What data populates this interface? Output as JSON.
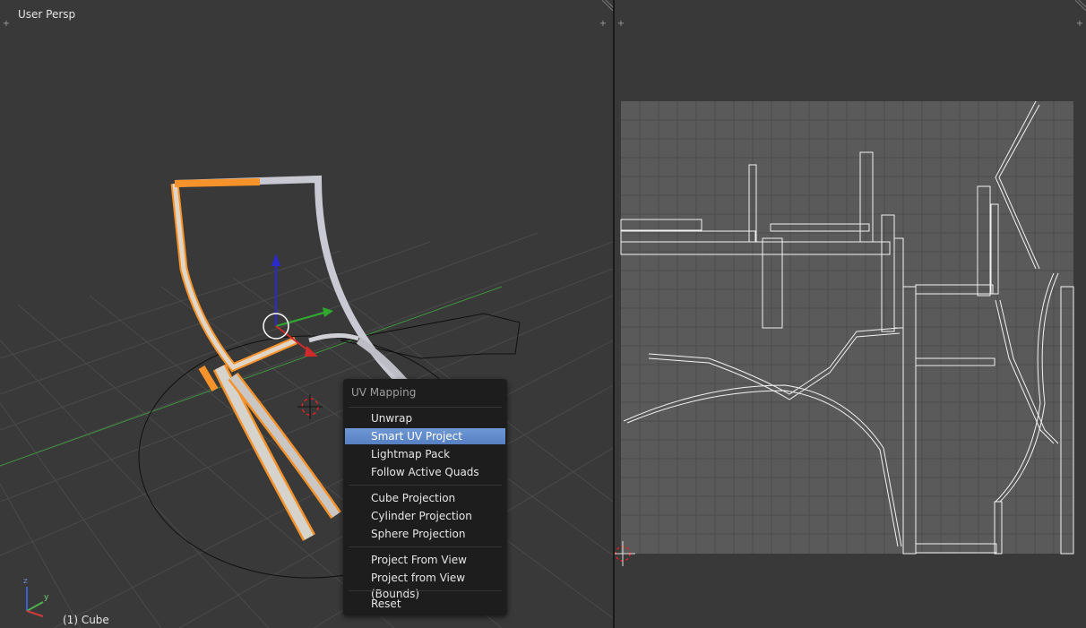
{
  "viewport": {
    "view_label": "User Persp",
    "object_label": "(1) Cube",
    "axes": {
      "z": "z",
      "y": "y"
    }
  },
  "uv_menu": {
    "title": "UV Mapping",
    "items": [
      {
        "label": "Unwrap",
        "group": 1,
        "active": false
      },
      {
        "label": "Smart UV Project",
        "group": 1,
        "active": true
      },
      {
        "label": "Lightmap Pack",
        "group": 1,
        "active": false
      },
      {
        "label": "Follow Active Quads",
        "group": 1,
        "active": false
      },
      {
        "label": "Cube Projection",
        "group": 2,
        "active": false
      },
      {
        "label": "Cylinder Projection",
        "group": 2,
        "active": false
      },
      {
        "label": "Sphere Projection",
        "group": 2,
        "active": false
      },
      {
        "label": "Project From View",
        "group": 3,
        "active": false
      },
      {
        "label": "Project from View (Bounds)",
        "group": 3,
        "active": false
      },
      {
        "label": "Reset",
        "group": 4,
        "active": false
      }
    ]
  },
  "colors": {
    "selected_edges": "#f5922a",
    "highlight": "#5680c2",
    "background": "#393939",
    "menu_bg": "#1d1d1d",
    "uv_grid_bg": "#5a5a5a"
  }
}
